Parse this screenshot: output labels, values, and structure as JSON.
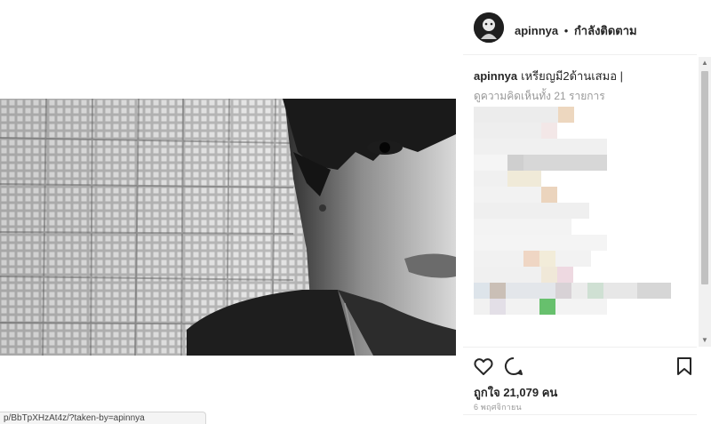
{
  "post": {
    "status_url": "p/BbTpXHzAt4z/?taken-by=apinnya"
  },
  "header": {
    "username": "apinnya",
    "separator": "•",
    "follow_status": "กำลังติดตาม"
  },
  "caption": {
    "username": "apinnya",
    "text": "เหรียญมี2ด้านเสมอ |"
  },
  "comments": {
    "view_all": "ดูความคิดเห็นทั้ง 21 รายการ"
  },
  "actions": {
    "likes": "ถูกใจ 21,079 คน",
    "date": "6 พฤศจิกายน"
  },
  "icons": [
    "heart-icon",
    "comment-icon",
    "bookmark-icon",
    "chevron-up-icon",
    "chevron-down-icon"
  ]
}
